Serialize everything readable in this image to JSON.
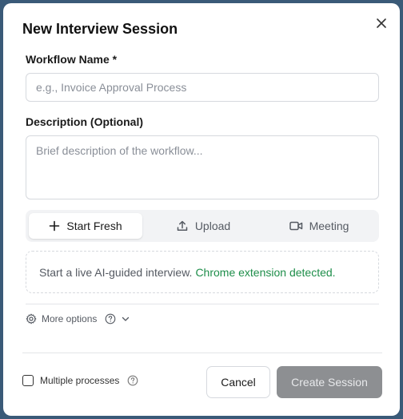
{
  "dialog": {
    "title": "New Interview Session",
    "close_icon": "close-icon"
  },
  "form": {
    "workflow_name": {
      "label": "Workflow Name *",
      "value": "",
      "placeholder": "e.g., Invoice Approval Process"
    },
    "description": {
      "label": "Description (Optional)",
      "value": "",
      "placeholder": "Brief description of the workflow..."
    }
  },
  "mode_tabs": [
    {
      "label": "Start Fresh",
      "icon": "plus-icon",
      "active": true
    },
    {
      "label": "Upload",
      "icon": "upload-icon",
      "active": false
    },
    {
      "label": "Meeting",
      "icon": "video-icon",
      "active": false
    }
  ],
  "notice": {
    "text": "Start a live AI-guided interview.",
    "status": "Chrome extension detected."
  },
  "more_options": {
    "label": "More options",
    "icons": [
      "gear-icon",
      "help-icon",
      "chevron-down-icon"
    ]
  },
  "footer": {
    "multiple_processes_label": "Multiple processes",
    "multiple_processes_checked": false,
    "cancel_label": "Cancel",
    "create_label": "Create Session",
    "create_enabled": false
  },
  "colors": {
    "status_green": "#1e8e4a",
    "create_disabled_bg": "#8d8f92"
  }
}
